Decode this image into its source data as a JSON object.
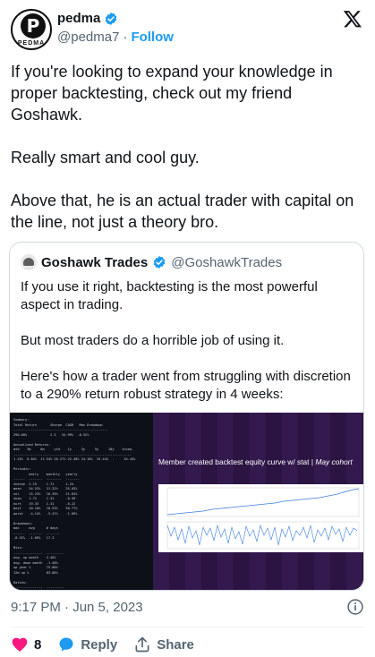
{
  "author": {
    "display_name": "pedma",
    "handle": "@pedma7",
    "separator": "·",
    "follow_label": "Follow",
    "avatar_letter": "P",
    "avatar_wordmark": "PEDMA"
  },
  "tweet": {
    "paragraphs": [
      "If you're looking to expand your knowledge in proper backtesting, check out my friend Goshawk.",
      "Really smart and cool guy.",
      "Above that, he is an actual trader with capital on the line, not just a theory bro."
    ]
  },
  "quote": {
    "display_name": "Goshawk Trades",
    "handle": "@GoshawkTrades",
    "paragraphs": [
      "If you use it right, backtesting is the most powerful aspect in trading.",
      "But most traders do a horrible job of using it.",
      "Here's how a trader went from struggling with discretion to a 290% return robust strategy in 4 weeks:"
    ],
    "media": {
      "caption_main": "Member created backtest equity curve w/ stat",
      "caption_sep": " | ",
      "caption_italic": "May cohort",
      "terminal_text": "Summary:\nTotal Return       Sharpe  CAGR   Max Drawdown\n-------------------------------------------------\n290.60%            2.3   34.99%  -8.32%\n\nAnnualized Returns:\nmtd    3m     6m     ytd    1y     3y     5y     10y    incep.\n-------------------------------------------------------------\n1.15%  0.84%  11.54% 26.27% 22.48% 24.18%  34.44%  -     34.44%\n\nPeriodic:\n        daily    monthly   yearly\n------  -------  --------  -------\nsharpe  2.19     1.71      1.24\nmean    34.53%   31.32%    35.03%\nvol     15.23%   16.39%    21.63%\nskew    1.72     1.31      -0.49\nkurt    19.33    1.31      -0.22\nbest    10.10%   10.53%    50.77%\nworst   -4.14%   -3.47%    -1.09%\n\nDrawdowns:\nmax     avg      # days\n------  -------  -------\n-8.32%  -1.09%   17.3\n\nMisc:\n---------------  ---------\navg. up month    4.40%\navg. down month  -1.48%\nup year %        75.00%\n12m up %         83.00%\n\nRatios:\n---------------  ---------\nwin rate         51.38%\nprofit factor    1.32"
    }
  },
  "meta": {
    "timestamp": "9:17 PM · Jun 5, 2023"
  },
  "actions": {
    "like_count": "8",
    "reply_label": "Reply",
    "share_label": "Share"
  },
  "colors": {
    "accent": "#1d9bf0",
    "like": "#f91880",
    "text": "#0f1419",
    "muted": "#536471"
  }
}
